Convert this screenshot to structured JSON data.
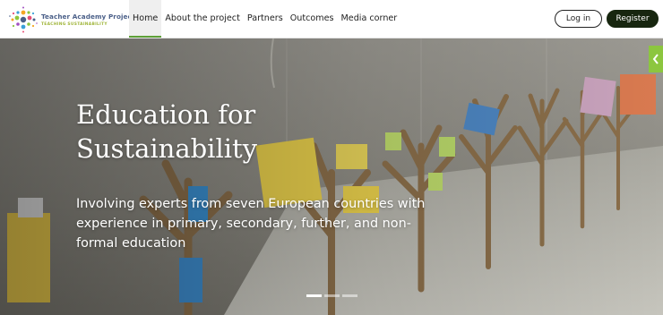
{
  "brand": {
    "title": "Teacher Academy Project",
    "subtitle": "TEACHING SUSTAINABILITY"
  },
  "nav": {
    "items": [
      {
        "label": "Home",
        "active": true
      },
      {
        "label": "About the project"
      },
      {
        "label": "Partners"
      },
      {
        "label": "Outcomes"
      },
      {
        "label": "Media corner"
      }
    ]
  },
  "auth": {
    "login_label": "Log in",
    "register_label": "Register"
  },
  "hero": {
    "title": "Education for Sustainability",
    "description": "Involving experts from seven European countries with experience in primary, secondary, further, and non-formal education",
    "slides": {
      "count": 3,
      "active": 1
    }
  },
  "colors": {
    "accent_green": "#8cc63f",
    "nav_active_underline": "#5ea038",
    "register_bg": "#17260f",
    "logo_text": "#4a5f88"
  },
  "icons": {
    "logo": "dotted-circle-logo",
    "side_tab": "chevron-left-icon"
  }
}
